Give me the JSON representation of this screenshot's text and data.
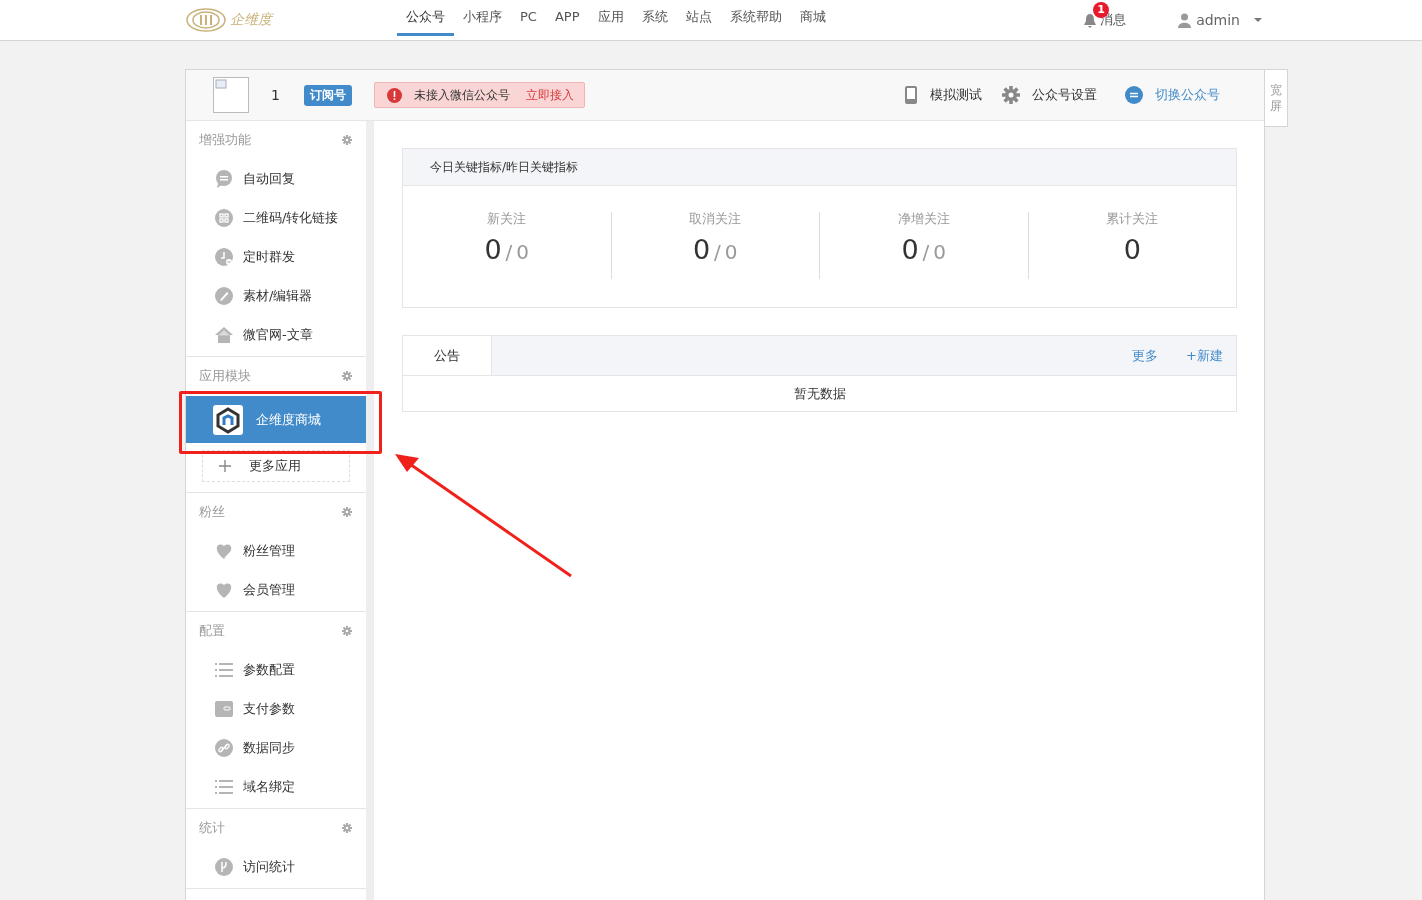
{
  "topbar": {
    "logo": "企维度",
    "nav": [
      {
        "label": "公众号",
        "selected": true
      },
      {
        "label": "小程序",
        "selected": false
      },
      {
        "label": "PC",
        "selected": false
      },
      {
        "label": "APP",
        "selected": false
      },
      {
        "label": "应用",
        "selected": false
      },
      {
        "label": "系统",
        "selected": false
      },
      {
        "label": "站点",
        "selected": false
      },
      {
        "label": "系统帮助",
        "selected": false
      },
      {
        "label": "商城",
        "selected": false
      }
    ],
    "messages": {
      "label": "消息",
      "badge": "1"
    },
    "user": "admin"
  },
  "account": {
    "name": "1",
    "type_badge": "订阅号",
    "alert": {
      "text": "未接入微信公众号",
      "link": "立即接入"
    },
    "actions": [
      {
        "kind": "phone",
        "label": "模拟测试"
      },
      {
        "kind": "gear",
        "label": "公众号设置"
      },
      {
        "kind": "switch",
        "label": "切换公众号"
      }
    ],
    "wide_tab": "宽屏"
  },
  "sidebar": [
    {
      "title": "增强功能",
      "items": [
        {
          "kind": "chat",
          "label": "自动回复",
          "selected": false
        },
        {
          "kind": "qrcode",
          "label": "二维码/转化链接",
          "selected": false
        },
        {
          "kind": "clock",
          "label": "定时群发",
          "selected": false
        },
        {
          "kind": "pencil",
          "label": "素材/编辑器",
          "selected": false
        },
        {
          "kind": "home",
          "label": "微官网-文章",
          "selected": false
        }
      ]
    },
    {
      "title": "应用模块",
      "items": [
        {
          "kind": "app",
          "label": "企维度商城",
          "selected": true
        }
      ],
      "more": "更多应用"
    },
    {
      "title": "粉丝",
      "items": [
        {
          "kind": "heartedit",
          "label": "粉丝管理",
          "selected": false
        },
        {
          "kind": "heart",
          "label": "会员管理",
          "selected": false
        }
      ]
    },
    {
      "title": "配置",
      "items": [
        {
          "kind": "list",
          "label": "参数配置",
          "selected": false
        },
        {
          "kind": "wallet",
          "label": "支付参数",
          "selected": false
        },
        {
          "kind": "link",
          "label": "数据同步",
          "selected": false
        },
        {
          "kind": "list",
          "label": "域名绑定",
          "selected": false
        }
      ]
    },
    {
      "title": "统计",
      "items": [
        {
          "kind": "branch",
          "label": "访问统计",
          "selected": false
        }
      ]
    }
  ],
  "stats_panel": {
    "title": "今日关键指标/昨日关键指标",
    "stats": [
      {
        "label": "新关注",
        "today": "0",
        "separator": "/",
        "yesterday": "0"
      },
      {
        "label": "取消关注",
        "today": "0",
        "separator": "/",
        "yesterday": "0"
      },
      {
        "label": "净增关注",
        "today": "0",
        "separator": "/",
        "yesterday": "0"
      },
      {
        "label": "累计关注",
        "today": "0"
      }
    ]
  },
  "notice_panel": {
    "tab": "公告",
    "links": [
      "更多",
      "+新建"
    ],
    "empty": "暂无数据"
  }
}
